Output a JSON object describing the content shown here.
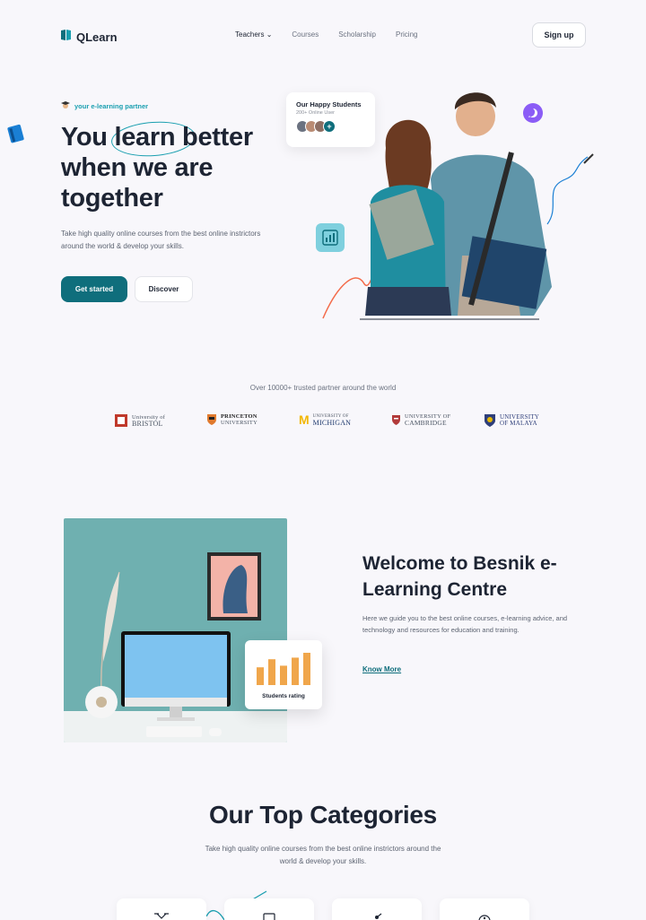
{
  "header": {
    "logo_text": "QLearn",
    "nav": [
      "Teachers",
      "Courses",
      "Scholarship",
      "Pricing"
    ],
    "signup_label": "Sign up"
  },
  "hero": {
    "tagline": "your e-learning partner",
    "title": "You learn better when we are together",
    "subtitle": "Take high quality online courses from the best online instrictors around the world & develop your skills.",
    "primary_button": "Get started",
    "secondary_button": "Discover",
    "happy_card": {
      "title": "Our Happy Students",
      "subtitle": "200+ Online User",
      "plus": "+"
    }
  },
  "partners": {
    "title": "Over 10000+ trusted partner around the world",
    "items": [
      {
        "line1": "University of",
        "line2": "BRISTOL"
      },
      {
        "line1": "PRINCETON",
        "line2": "UNIVERSITY"
      },
      {
        "line1": "UNIVERSITY OF",
        "line2": "MICHIGAN"
      },
      {
        "line1": "UNIVERSITY OF",
        "line2": "CAMBRIDGE"
      },
      {
        "line1": "UNIVERSITY",
        "line2": "OF MALAYA"
      }
    ]
  },
  "welcome": {
    "title": "Welcome to Besnik e-Learning Centre",
    "text": "Here we guide you to the best online courses, e-learning advice, and technology and resources for education and training.",
    "link": "Know More",
    "rating_label": "Students rating",
    "rating_bars": [
      0.55,
      0.8,
      0.6,
      0.85,
      1.0
    ]
  },
  "categories": {
    "title": "Our Top Categories",
    "subtitle": "Take high quality online courses from the best online instrictors around the world & develop your skills."
  },
  "colors": {
    "primary": "#0f6e7c",
    "accent": "#1a9fb0",
    "bar": "#f0a64b"
  }
}
